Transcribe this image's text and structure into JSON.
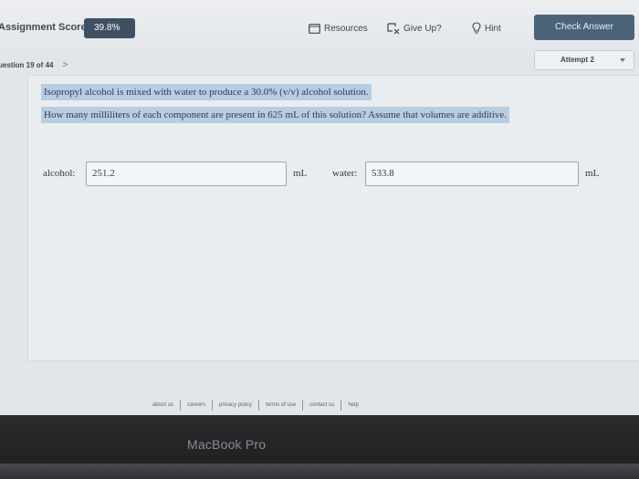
{
  "header": {
    "score_label": "Assignment Score:",
    "score_value": "39.8%",
    "resources_label": "Resources",
    "giveup_label": "Give Up?",
    "hint_label": "Hint",
    "check_label": "Check Answer"
  },
  "nav": {
    "question_label": "uestion 19 of 44",
    "next_arrow": ">",
    "attempt_label": "Attempt 2"
  },
  "question": {
    "line1": "Isopropyl alcohol is mixed with water to produce a 30.0% (v/v) alcohol solution.",
    "line2": "How many milliliters of each component are present in 625 mL of this solution? Assume that volumes are additive."
  },
  "answers": {
    "alcohol_label": "alcohol:",
    "alcohol_value": "251.2",
    "alcohol_unit": "mL",
    "water_label": "water:",
    "water_value": "533.8",
    "water_unit": "mL"
  },
  "footer": {
    "links": [
      "about us",
      "careers",
      "privacy policy",
      "terms of use",
      "contact us",
      "help"
    ]
  },
  "device": {
    "brand": "MacBook Pro"
  },
  "colors": {
    "accent": "#4b6379",
    "score_badge": "#3f5063",
    "highlight": "#b8cde2"
  },
  "icons": [
    "resources-icon",
    "give-up-icon",
    "hint-icon",
    "chevron-right-icon",
    "caret-down-icon"
  ]
}
